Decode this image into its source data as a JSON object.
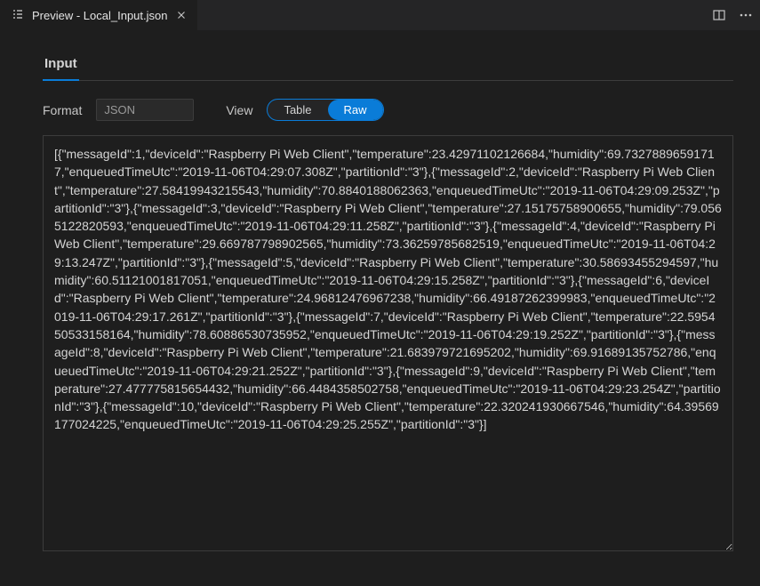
{
  "tab": {
    "title": "Preview - Local_Input.json"
  },
  "section": {
    "activeTab": "Input"
  },
  "controls": {
    "formatLabel": "Format",
    "formatValue": "JSON",
    "viewLabel": "View",
    "viewOptions": {
      "table": "Table",
      "raw": "Raw"
    }
  },
  "records": [
    {
      "messageId": 1,
      "deviceId": "Raspberry Pi Web Client",
      "temperature": 23.42971102126684,
      "humidity": 69.73278896591717,
      "enqueuedTimeUtc": "2019-11-06T04:29:07.308Z",
      "partitionId": "3"
    },
    {
      "messageId": 2,
      "deviceId": "Raspberry Pi Web Client",
      "temperature": 27.58419943215543,
      "humidity": 70.8840188062363,
      "enqueuedTimeUtc": "2019-11-06T04:29:09.253Z",
      "partitionId": "3"
    },
    {
      "messageId": 3,
      "deviceId": "Raspberry Pi Web Client",
      "temperature": 27.15175758900655,
      "humidity": 79.0565122820593,
      "enqueuedTimeUtc": "2019-11-06T04:29:11.258Z",
      "partitionId": "3"
    },
    {
      "messageId": 4,
      "deviceId": "Raspberry Pi Web Client",
      "temperature": 29.669787798902565,
      "humidity": 73.36259785682519,
      "enqueuedTimeUtc": "2019-11-06T04:29:13.247Z",
      "partitionId": "3"
    },
    {
      "messageId": 5,
      "deviceId": "Raspberry Pi Web Client",
      "temperature": 30.58693455294597,
      "humidity": 60.51121001817051,
      "enqueuedTimeUtc": "2019-11-06T04:29:15.258Z",
      "partitionId": "3"
    },
    {
      "messageId": 6,
      "deviceId": "Raspberry Pi Web Client",
      "temperature": 24.96812476967238,
      "humidity": 66.49187262399983,
      "enqueuedTimeUtc": "2019-11-06T04:29:17.261Z",
      "partitionId": "3"
    },
    {
      "messageId": 7,
      "deviceId": "Raspberry Pi Web Client",
      "temperature": 22.595450533158164,
      "humidity": 78.60886530735952,
      "enqueuedTimeUtc": "2019-11-06T04:29:19.252Z",
      "partitionId": "3"
    },
    {
      "messageId": 8,
      "deviceId": "Raspberry Pi Web Client",
      "temperature": 21.683979721695202,
      "humidity": 69.91689135752786,
      "enqueuedTimeUtc": "2019-11-06T04:29:21.252Z",
      "partitionId": "3"
    },
    {
      "messageId": 9,
      "deviceId": "Raspberry Pi Web Client",
      "temperature": 27.477775815654432,
      "humidity": 66.4484358502758,
      "enqueuedTimeUtc": "2019-11-06T04:29:23.254Z",
      "partitionId": "3"
    },
    {
      "messageId": 10,
      "deviceId": "Raspberry Pi Web Client",
      "temperature": 22.320241930667546,
      "humidity": 64.39569177024225,
      "enqueuedTimeUtc": "2019-11-06T04:29:25.255Z",
      "partitionId": "3"
    }
  ]
}
